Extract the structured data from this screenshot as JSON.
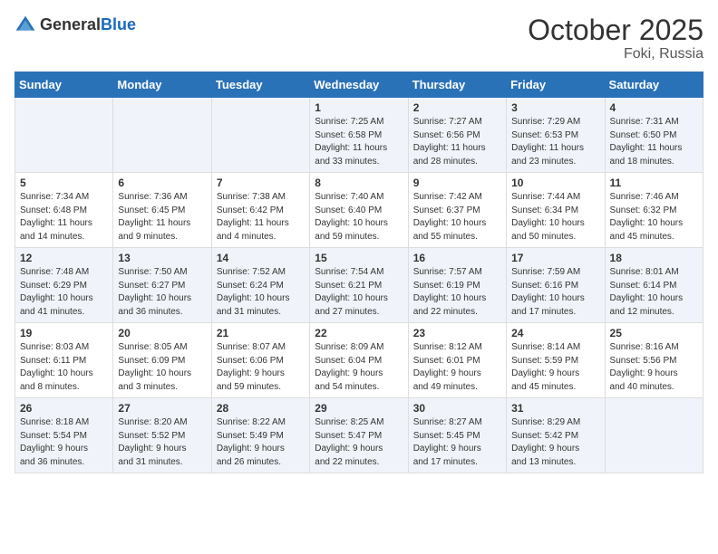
{
  "logo": {
    "general": "General",
    "blue": "Blue"
  },
  "title": "October 2025",
  "location": "Foki, Russia",
  "days_header": [
    "Sunday",
    "Monday",
    "Tuesday",
    "Wednesday",
    "Thursday",
    "Friday",
    "Saturday"
  ],
  "weeks": [
    [
      {
        "day": "",
        "content": ""
      },
      {
        "day": "",
        "content": ""
      },
      {
        "day": "",
        "content": ""
      },
      {
        "day": "1",
        "content": "Sunrise: 7:25 AM\nSunset: 6:58 PM\nDaylight: 11 hours\nand 33 minutes."
      },
      {
        "day": "2",
        "content": "Sunrise: 7:27 AM\nSunset: 6:56 PM\nDaylight: 11 hours\nand 28 minutes."
      },
      {
        "day": "3",
        "content": "Sunrise: 7:29 AM\nSunset: 6:53 PM\nDaylight: 11 hours\nand 23 minutes."
      },
      {
        "day": "4",
        "content": "Sunrise: 7:31 AM\nSunset: 6:50 PM\nDaylight: 11 hours\nand 18 minutes."
      }
    ],
    [
      {
        "day": "5",
        "content": "Sunrise: 7:34 AM\nSunset: 6:48 PM\nDaylight: 11 hours\nand 14 minutes."
      },
      {
        "day": "6",
        "content": "Sunrise: 7:36 AM\nSunset: 6:45 PM\nDaylight: 11 hours\nand 9 minutes."
      },
      {
        "day": "7",
        "content": "Sunrise: 7:38 AM\nSunset: 6:42 PM\nDaylight: 11 hours\nand 4 minutes."
      },
      {
        "day": "8",
        "content": "Sunrise: 7:40 AM\nSunset: 6:40 PM\nDaylight: 10 hours\nand 59 minutes."
      },
      {
        "day": "9",
        "content": "Sunrise: 7:42 AM\nSunset: 6:37 PM\nDaylight: 10 hours\nand 55 minutes."
      },
      {
        "day": "10",
        "content": "Sunrise: 7:44 AM\nSunset: 6:34 PM\nDaylight: 10 hours\nand 50 minutes."
      },
      {
        "day": "11",
        "content": "Sunrise: 7:46 AM\nSunset: 6:32 PM\nDaylight: 10 hours\nand 45 minutes."
      }
    ],
    [
      {
        "day": "12",
        "content": "Sunrise: 7:48 AM\nSunset: 6:29 PM\nDaylight: 10 hours\nand 41 minutes."
      },
      {
        "day": "13",
        "content": "Sunrise: 7:50 AM\nSunset: 6:27 PM\nDaylight: 10 hours\nand 36 minutes."
      },
      {
        "day": "14",
        "content": "Sunrise: 7:52 AM\nSunset: 6:24 PM\nDaylight: 10 hours\nand 31 minutes."
      },
      {
        "day": "15",
        "content": "Sunrise: 7:54 AM\nSunset: 6:21 PM\nDaylight: 10 hours\nand 27 minutes."
      },
      {
        "day": "16",
        "content": "Sunrise: 7:57 AM\nSunset: 6:19 PM\nDaylight: 10 hours\nand 22 minutes."
      },
      {
        "day": "17",
        "content": "Sunrise: 7:59 AM\nSunset: 6:16 PM\nDaylight: 10 hours\nand 17 minutes."
      },
      {
        "day": "18",
        "content": "Sunrise: 8:01 AM\nSunset: 6:14 PM\nDaylight: 10 hours\nand 12 minutes."
      }
    ],
    [
      {
        "day": "19",
        "content": "Sunrise: 8:03 AM\nSunset: 6:11 PM\nDaylight: 10 hours\nand 8 minutes."
      },
      {
        "day": "20",
        "content": "Sunrise: 8:05 AM\nSunset: 6:09 PM\nDaylight: 10 hours\nand 3 minutes."
      },
      {
        "day": "21",
        "content": "Sunrise: 8:07 AM\nSunset: 6:06 PM\nDaylight: 9 hours\nand 59 minutes."
      },
      {
        "day": "22",
        "content": "Sunrise: 8:09 AM\nSunset: 6:04 PM\nDaylight: 9 hours\nand 54 minutes."
      },
      {
        "day": "23",
        "content": "Sunrise: 8:12 AM\nSunset: 6:01 PM\nDaylight: 9 hours\nand 49 minutes."
      },
      {
        "day": "24",
        "content": "Sunrise: 8:14 AM\nSunset: 5:59 PM\nDaylight: 9 hours\nand 45 minutes."
      },
      {
        "day": "25",
        "content": "Sunrise: 8:16 AM\nSunset: 5:56 PM\nDaylight: 9 hours\nand 40 minutes."
      }
    ],
    [
      {
        "day": "26",
        "content": "Sunrise: 8:18 AM\nSunset: 5:54 PM\nDaylight: 9 hours\nand 36 minutes."
      },
      {
        "day": "27",
        "content": "Sunrise: 8:20 AM\nSunset: 5:52 PM\nDaylight: 9 hours\nand 31 minutes."
      },
      {
        "day": "28",
        "content": "Sunrise: 8:22 AM\nSunset: 5:49 PM\nDaylight: 9 hours\nand 26 minutes."
      },
      {
        "day": "29",
        "content": "Sunrise: 8:25 AM\nSunset: 5:47 PM\nDaylight: 9 hours\nand 22 minutes."
      },
      {
        "day": "30",
        "content": "Sunrise: 8:27 AM\nSunset: 5:45 PM\nDaylight: 9 hours\nand 17 minutes."
      },
      {
        "day": "31",
        "content": "Sunrise: 8:29 AM\nSunset: 5:42 PM\nDaylight: 9 hours\nand 13 minutes."
      },
      {
        "day": "",
        "content": ""
      }
    ]
  ]
}
